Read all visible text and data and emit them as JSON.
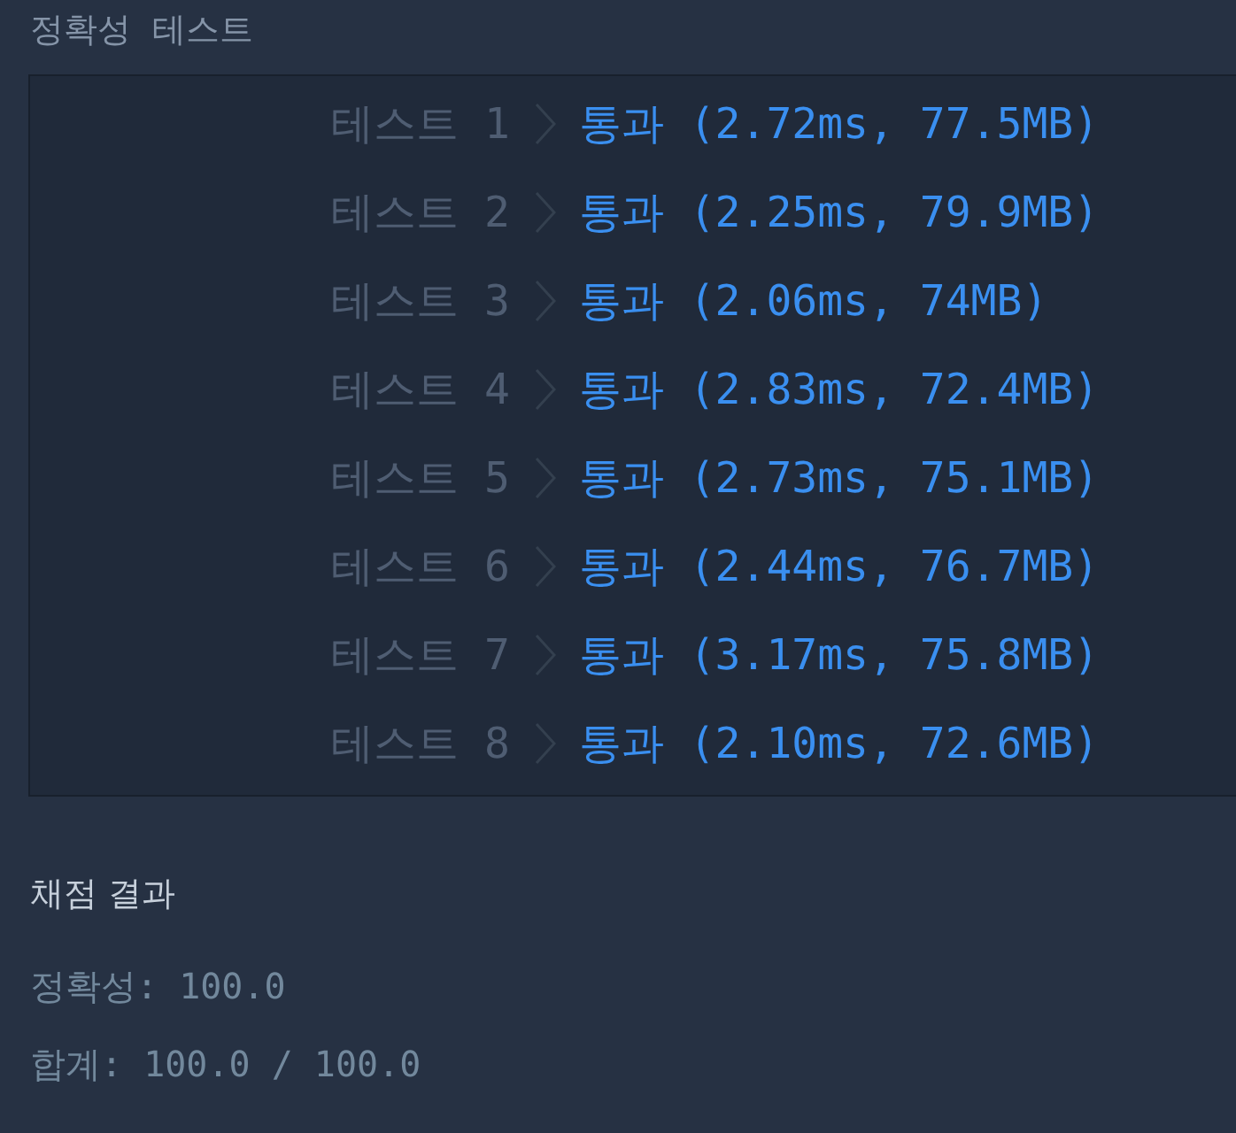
{
  "section_title": "정확성  테스트",
  "tests": [
    {
      "label": "테스트 1",
      "result": "통과 (2.72ms, 77.5MB)"
    },
    {
      "label": "테스트 2",
      "result": "통과 (2.25ms, 79.9MB)"
    },
    {
      "label": "테스트 3",
      "result": "통과 (2.06ms, 74MB)"
    },
    {
      "label": "테스트 4",
      "result": "통과 (2.83ms, 72.4MB)"
    },
    {
      "label": "테스트 5",
      "result": "통과 (2.73ms, 75.1MB)"
    },
    {
      "label": "테스트 6",
      "result": "통과 (2.44ms, 76.7MB)"
    },
    {
      "label": "테스트 7",
      "result": "통과 (3.17ms, 75.8MB)"
    },
    {
      "label": "테스트 8",
      "result": "통과 (2.10ms, 72.6MB)"
    }
  ],
  "summary": {
    "title": "채점 결과",
    "lines": [
      "정확성: 100.0",
      "합계: 100.0 / 100.0"
    ]
  }
}
